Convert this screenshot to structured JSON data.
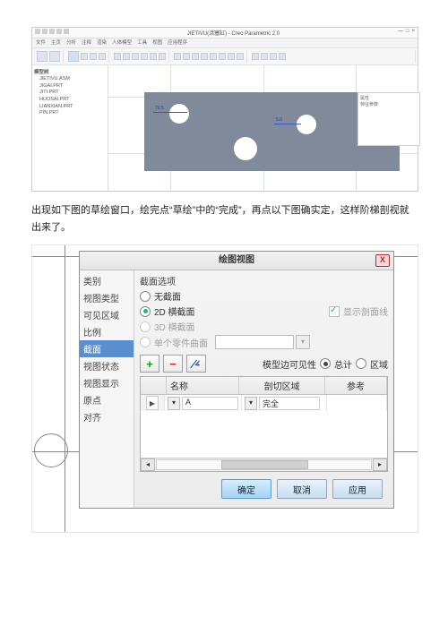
{
  "cad": {
    "title": "JIETIVU(活塞缸) - Creo Parametric 2.0",
    "menus": [
      "文件",
      "主页",
      "分析",
      "注释",
      "渲染",
      "人体模型",
      "工具",
      "视图",
      "应用程序"
    ],
    "tree": {
      "title": "模型树",
      "items": [
        "JIETIVU.ASM",
        "JIGAI.PRT",
        "JITI.PRT",
        "HUOSAI.PRT",
        "LIANXIAN.PRT",
        "PIN.PRT"
      ]
    },
    "dims": {
      "d1": "70.5",
      "d2": "5.0"
    },
    "prop": {
      "title": "属性",
      "item": "特征参数"
    }
  },
  "body_text": "出现如下图的草绘窗口，绘完点“草绘”中的“完成”，再点以下图确实定，这样阶梯剖视就出来了。",
  "dialog": {
    "title": "绘图视图",
    "tabs": [
      "类别",
      "视图类型",
      "可见区域",
      "比例",
      "截面",
      "视图状态",
      "视图显示",
      "原点",
      "对齐"
    ],
    "selected_tab": "截面",
    "section_options": {
      "group_label": "截面选项",
      "none": "无截面",
      "xsec2d": "2D 横截面",
      "xsec3d": "3D 横截面",
      "single": "单个零件曲面",
      "show_xhatch": "显示剖面线"
    },
    "visibility": {
      "label": "模型边可见性",
      "total": "总计",
      "area": "区域"
    },
    "table": {
      "headers": {
        "name": "名称",
        "region": "剖切区域",
        "ref": "参考"
      },
      "row": {
        "selector": "▶",
        "name": "A",
        "region": "完全"
      }
    },
    "buttons": {
      "ok": "确定",
      "cancel": "取消",
      "apply": "应用"
    },
    "close": "X"
  }
}
